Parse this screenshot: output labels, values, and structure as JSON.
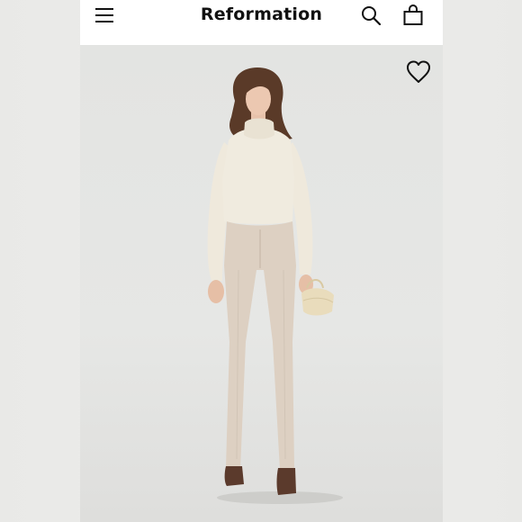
{
  "header": {
    "brand": "Reformation",
    "menu_icon": "hamburger-menu-icon",
    "search_icon": "search-icon",
    "bag_icon": "shopping-bag-icon"
  },
  "product": {
    "favorite_icon": "heart-outline-icon",
    "image_description_colors": {
      "sweater": "#efe9dc",
      "pants": "#ddd0c2",
      "hair": "#5a3a28",
      "boots": "#5b3a2c",
      "bag": "#e9dcbc"
    }
  }
}
